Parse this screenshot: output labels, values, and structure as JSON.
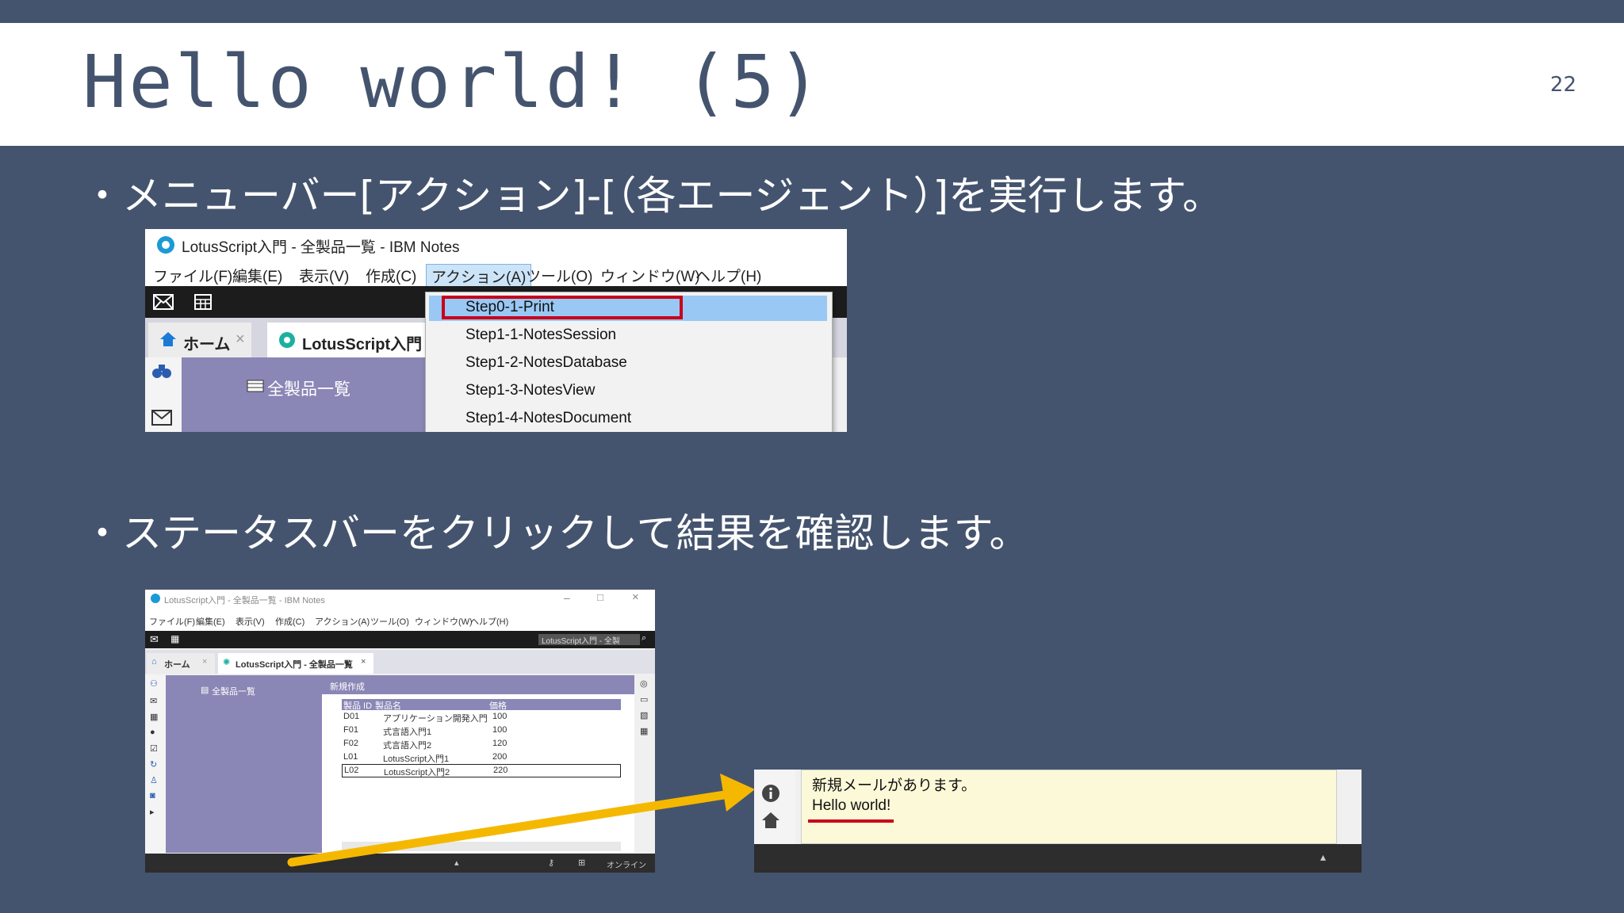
{
  "slide": {
    "title": "Hello world! (5)",
    "page_number": "22",
    "bullet1": "・メニューバー[アクション]-[（各エージェント）]を実行します。",
    "bullet2": "・ステータスバーをクリックして結果を確認します。"
  },
  "shot1": {
    "app_title": "LotusScript入門 - 全製品一覧 - IBM Notes",
    "menu": [
      "ファイル(F)",
      "編集(E)",
      "表示(V)",
      "作成(C)",
      "アクション(A)",
      "ツール(O)",
      "ウィンドウ(W)",
      "ヘルプ(H)"
    ],
    "tab_home": "ホーム",
    "tab_active": "LotusScript入門",
    "nav_view": "全製品一覧",
    "dropdown_items": [
      "Step0-1-Print",
      "Step1-1-NotesSession",
      "Step1-2-NotesDatabase",
      "Step1-3-NotesView",
      "Step1-4-NotesDocument"
    ]
  },
  "shot2": {
    "app_title": "LotusScript入門 - 全製品一覧 - IBM Notes",
    "menu": [
      "ファイル(F)",
      "編集(E)",
      "表示(V)",
      "作成(C)",
      "アクション(A)",
      "ツール(O)",
      "ウィンドウ(W)",
      "ヘルプ(H)"
    ],
    "search_text": "LotusScript入門 - 全製",
    "tab_home": "ホーム",
    "tab_active": "LotusScript入門 - 全製品一覧",
    "nav_view": "全製品一覧",
    "new_button": "新規作成",
    "columns": [
      "製品 ID",
      "製品名",
      "価格"
    ],
    "rows": [
      [
        "D01",
        "アプリケーション開発入門",
        "100"
      ],
      [
        "F01",
        "式言語入門1",
        "100"
      ],
      [
        "F02",
        "式言語入門2",
        "120"
      ],
      [
        "L01",
        "LotusScript入門1",
        "200"
      ],
      [
        "L02",
        "LotusScript入門2",
        "220"
      ]
    ],
    "status_online": "オンライン"
  },
  "shot3": {
    "message1": "新規メールがあります。",
    "message2": "Hello world!"
  },
  "colors": {
    "background": "#45546e",
    "highlight": "#c8001a",
    "arrow": "#f5b800",
    "nav": "#8a86b5"
  }
}
